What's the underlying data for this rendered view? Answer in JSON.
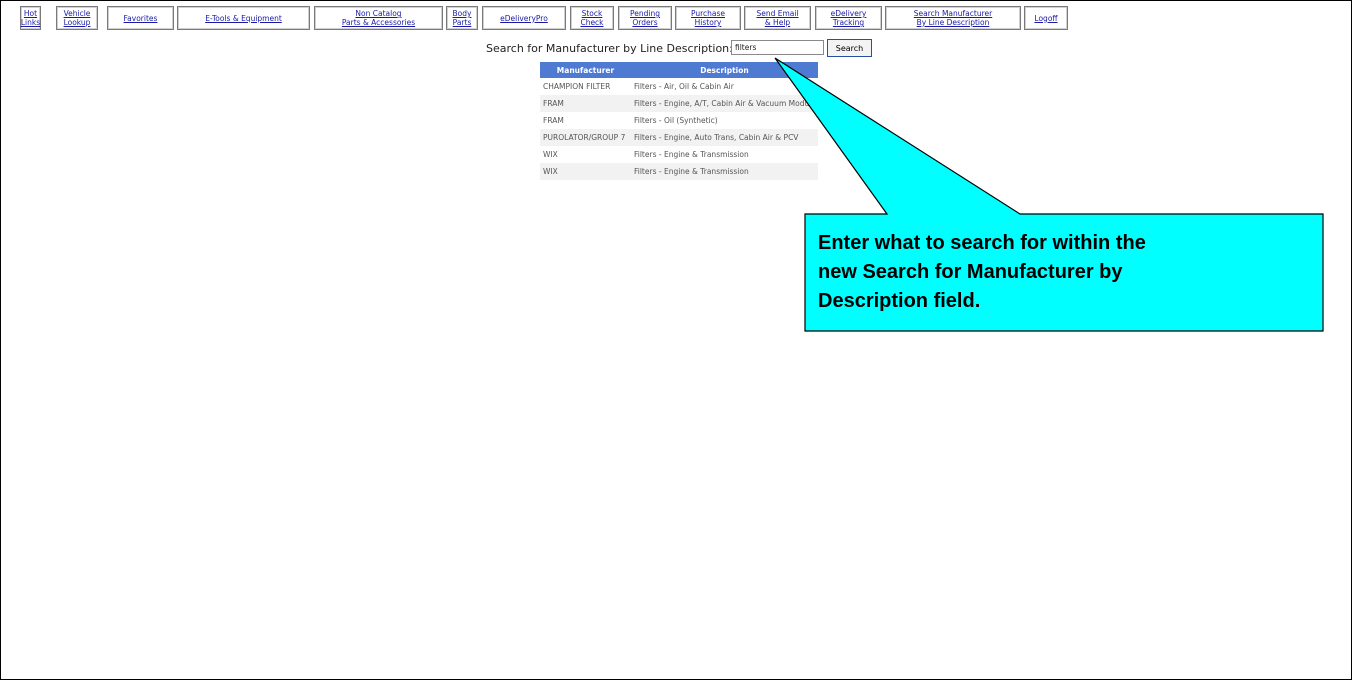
{
  "nav": [
    {
      "id": "hot-links",
      "label": "Hot\nLinks"
    },
    {
      "id": "vehicle-lookup",
      "label": "Vehicle\nLookup"
    },
    {
      "id": "favorites",
      "label": "Favorites"
    },
    {
      "id": "e-tools",
      "label": "E-Tools & Equipment"
    },
    {
      "id": "non-catalog",
      "label": "Non Catalog\nParts & Accessories"
    },
    {
      "id": "body-parts",
      "label": "Body\nParts"
    },
    {
      "id": "edeliverypro",
      "label": "eDeliveryPro"
    },
    {
      "id": "stock-check",
      "label": "Stock\nCheck"
    },
    {
      "id": "pending-orders",
      "label": "Pending\nOrders"
    },
    {
      "id": "purchase-history",
      "label": "Purchase\nHistory"
    },
    {
      "id": "send-email-help",
      "label": "Send Email\n& Help"
    },
    {
      "id": "edelivery-tracking",
      "label": "eDelivery\nTracking"
    },
    {
      "id": "search-manufacturer",
      "label": "Search Manufacturer\nBy Line Description"
    },
    {
      "id": "logoff",
      "label": "Logoff"
    }
  ],
  "search": {
    "label": "Search for Manufacturer by Line Description:",
    "value": "filters",
    "button_label": "Search"
  },
  "table": {
    "headers": [
      "Manufacturer",
      "Description"
    ],
    "rows": [
      [
        "CHAMPION FILTER",
        "Filters - Air, Oil & Cabin Air"
      ],
      [
        "FRAM",
        "Filters - Engine, A/T, Cabin Air & Vacuum Modul"
      ],
      [
        "FRAM",
        "Filters - Oil (Synthetic)"
      ],
      [
        "PUROLATOR/GROUP 7",
        "Filters - Engine, Auto Trans, Cabin Air & PCV"
      ],
      [
        "WIX",
        "Filters - Engine & Transmission"
      ],
      [
        "WIX",
        "Filters - Engine & Transmission"
      ]
    ]
  },
  "callout": {
    "lines": [
      "Enter what to search for within the",
      "new Search for Manufacturer by",
      "Description field."
    ],
    "fill_color": "#00ffff"
  }
}
